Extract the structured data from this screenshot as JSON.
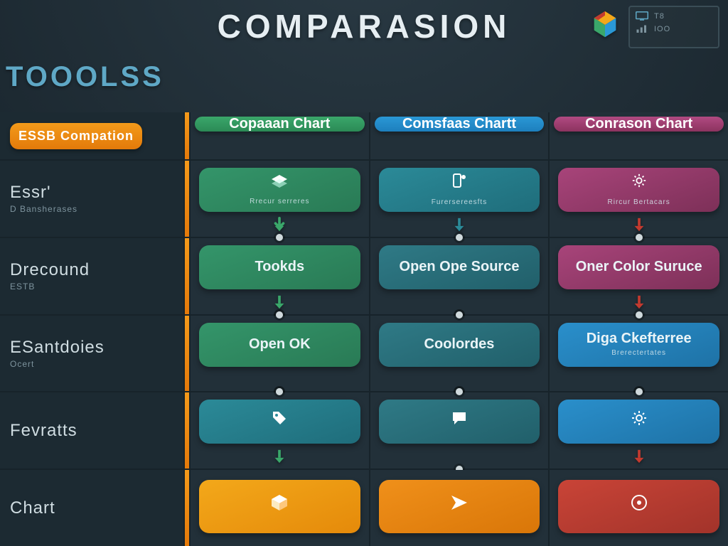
{
  "header": {
    "title": "COMPARASION",
    "subtitle": "TOOOLSS",
    "panel": {
      "line1": "T8",
      "line2": "IOO"
    }
  },
  "chart_data": {
    "type": "table",
    "title": "COMPARASION",
    "row_header": "ESSB Compation",
    "rows": [
      {
        "label": "Essr'",
        "sub": "D Bansherases"
      },
      {
        "label": "Drecound",
        "sub": "ESTB"
      },
      {
        "label": "ESantdoies",
        "sub": "Ocert"
      },
      {
        "label": "Fevratts",
        "sub": ""
      },
      {
        "label": "Chart",
        "sub": ""
      }
    ],
    "columns": [
      {
        "label": "Copaaan Chart",
        "color": "green"
      },
      {
        "label": "Comsfaas Chartt",
        "color": "blue"
      },
      {
        "label": "Conrason Chart",
        "color": "pink"
      }
    ],
    "cells": [
      [
        {
          "icon": "layers-icon",
          "label": "",
          "sub": "Rrecur serreres",
          "card": "green",
          "arrow": "green"
        },
        {
          "icon": "device-icon",
          "label": "",
          "sub": "Furersereesfts",
          "card": "teal2",
          "arrow": "teal"
        },
        {
          "icon": "gear-icon",
          "label": "",
          "sub": "Rircur Bertacars",
          "card": "pink",
          "arrow": "red"
        }
      ],
      [
        {
          "icon": "",
          "label": "Tookds",
          "sub": "",
          "card": "green",
          "arrow": "green"
        },
        {
          "icon": "",
          "label": "Open Ope Source",
          "sub": "",
          "card": "teal",
          "arrow": "teal"
        },
        {
          "icon": "",
          "label": "Oner Color Suruce",
          "sub": "",
          "card": "pink",
          "arrow": "red"
        }
      ],
      [
        {
          "icon": "",
          "label": "Open OK",
          "sub": "",
          "card": "green",
          "arrow": ""
        },
        {
          "icon": "",
          "label": "Coolordes",
          "sub": "",
          "card": "teal",
          "arrow": ""
        },
        {
          "icon": "",
          "label": "Diga Ckefterree",
          "sub": "Brerectertates",
          "card": "blue",
          "arrow": ""
        }
      ],
      [
        {
          "icon": "tag-icon",
          "label": "",
          "sub": "",
          "card": "teal2",
          "arrow": "green"
        },
        {
          "icon": "chat-icon",
          "label": "",
          "sub": "",
          "card": "teal",
          "arrow": ""
        },
        {
          "icon": "gear-icon",
          "label": "",
          "sub": "",
          "card": "blue",
          "arrow": "red"
        }
      ],
      [
        {
          "icon": "cube-icon",
          "label": "",
          "sub": "",
          "card": "orange",
          "arrow": ""
        },
        {
          "icon": "send-icon",
          "label": "",
          "sub": "",
          "card": "orange2",
          "arrow": ""
        },
        {
          "icon": "alert-icon",
          "label": "",
          "sub": "",
          "card": "red",
          "arrow": ""
        }
      ]
    ]
  }
}
